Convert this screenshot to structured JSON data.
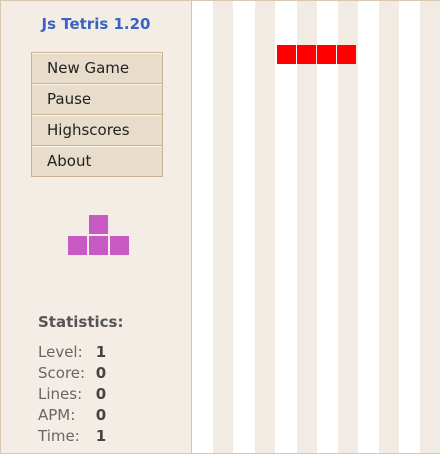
{
  "app": {
    "title": "Js Tetris 1.20"
  },
  "menu": {
    "new_game": "New Game",
    "pause": "Pause",
    "highscores": "Highscores",
    "about": "About"
  },
  "next_piece": {
    "shape": "T",
    "color": "#c75bc3"
  },
  "statistics": {
    "title": "Statistics:",
    "level_label": "Level:",
    "level": "1",
    "score_label": "Score:",
    "score": "0",
    "lines_label": "Lines:",
    "lines": "0",
    "apm_label": "APM:",
    "apm": "0",
    "time_label": "Time:",
    "time": "1"
  },
  "board": {
    "active_piece": {
      "shape": "I",
      "color": "#ff0000"
    }
  }
}
